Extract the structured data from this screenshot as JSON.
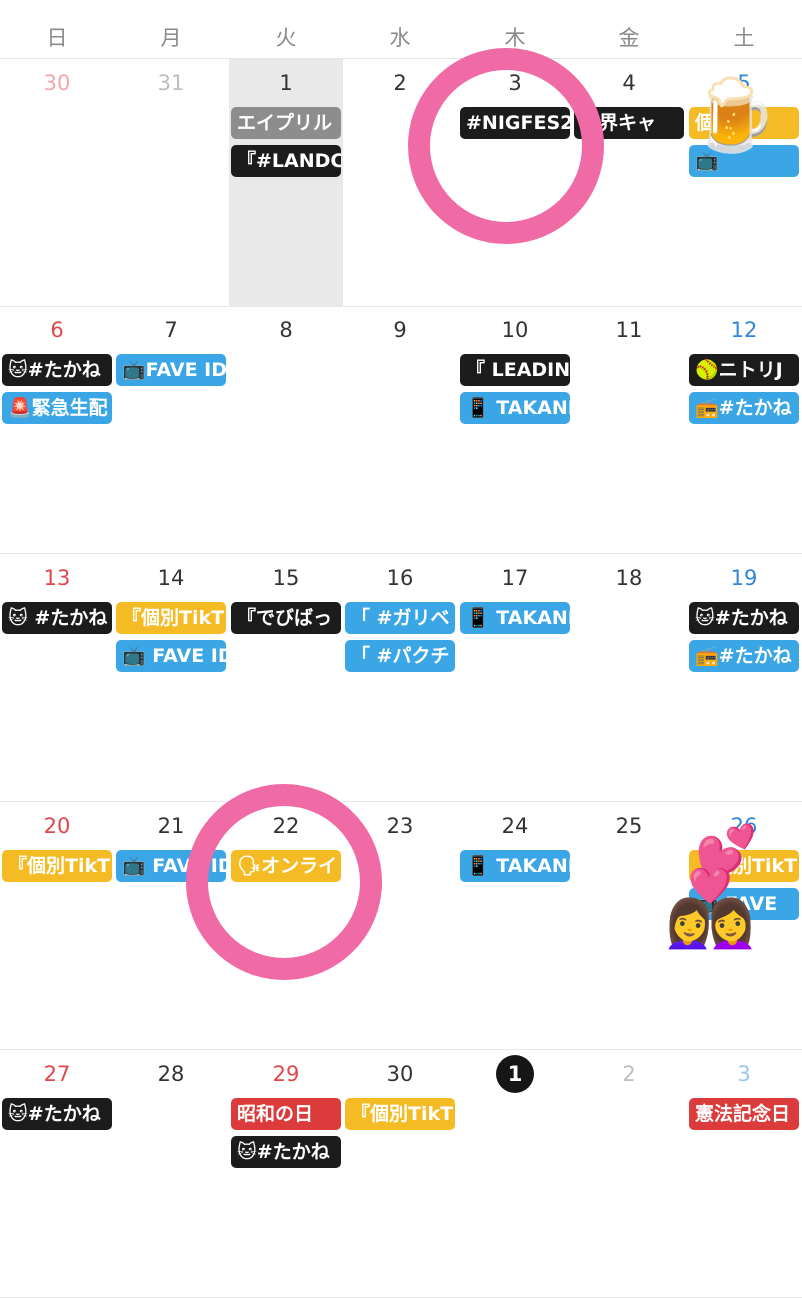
{
  "weekdays": [
    "日",
    "月",
    "火",
    "水",
    "木",
    "金",
    "土"
  ],
  "colors": {
    "black": "#1c1c1c",
    "blue": "#3ba6e6",
    "yellow": "#f5bb24",
    "gray": "#8d8d8d",
    "red": "#db3b3a",
    "highlight_ring": "#f06aa6",
    "today_bg": "#161616"
  },
  "weeks": [
    {
      "days": [
        {
          "num": "30",
          "muted": true,
          "events": []
        },
        {
          "num": "31",
          "muted": true,
          "events": []
        },
        {
          "num": "1",
          "highlight": true,
          "events": [
            {
              "text": "エイプリル",
              "color": "gray"
            },
            {
              "text": "『#LANDC",
              "color": "black"
            }
          ]
        },
        {
          "num": "2",
          "events": []
        },
        {
          "num": "3",
          "events": [
            {
              "text": "#NIGFES2(",
              "color": "black"
            }
          ]
        },
        {
          "num": "4",
          "events": [
            {
              "text": "世界キャ",
              "color": "black"
            }
          ]
        },
        {
          "num": "5",
          "events": [
            {
              "text": "個別",
              "color": "yellow"
            },
            {
              "text": "📺",
              "color": "blue"
            }
          ]
        }
      ]
    },
    {
      "days": [
        {
          "num": "6",
          "events": [
            {
              "text": "🐱#たかね",
              "color": "black"
            },
            {
              "text": "🚨緊急生配",
              "color": "blue"
            }
          ]
        },
        {
          "num": "7",
          "events": [
            {
              "text": "📺FAVE ID",
              "color": "blue"
            }
          ]
        },
        {
          "num": "8",
          "events": []
        },
        {
          "num": "9",
          "events": []
        },
        {
          "num": "10",
          "events": [
            {
              "text": "『 LEADING",
              "color": "black"
            },
            {
              "text": "📱 TAKANE",
              "color": "blue"
            }
          ]
        },
        {
          "num": "11",
          "events": []
        },
        {
          "num": "12",
          "events": [
            {
              "text": "🥎ニトリJ",
              "color": "black"
            },
            {
              "text": "📻#たかね",
              "color": "blue"
            }
          ]
        }
      ]
    },
    {
      "days": [
        {
          "num": "13",
          "events": [
            {
              "text": "🐱 #たかね",
              "color": "black"
            }
          ]
        },
        {
          "num": "14",
          "events": [
            {
              "text": "『個別TikT",
              "color": "yellow"
            },
            {
              "text": "📺 FAVE ID",
              "color": "blue"
            }
          ]
        },
        {
          "num": "15",
          "events": [
            {
              "text": "『でびばっ",
              "color": "black"
            }
          ]
        },
        {
          "num": "16",
          "events": [
            {
              "text": "「 #ガリベ",
              "color": "blue"
            },
            {
              "text": "「 #パクチ",
              "color": "blue"
            }
          ]
        },
        {
          "num": "17",
          "events": [
            {
              "text": "📱 TAKANE",
              "color": "blue"
            }
          ]
        },
        {
          "num": "18",
          "events": []
        },
        {
          "num": "19",
          "events": [
            {
              "text": "🐱#たかね",
              "color": "black"
            },
            {
              "text": "📻#たかね",
              "color": "blue"
            }
          ]
        }
      ]
    },
    {
      "days": [
        {
          "num": "20",
          "events": [
            {
              "text": "『個別TikT",
              "color": "yellow"
            }
          ]
        },
        {
          "num": "21",
          "events": [
            {
              "text": "📺 FAVE ID",
              "color": "blue"
            }
          ]
        },
        {
          "num": "22",
          "events": [
            {
              "text": "🗣オンライ",
              "color": "yellow"
            }
          ]
        },
        {
          "num": "23",
          "events": []
        },
        {
          "num": "24",
          "events": [
            {
              "text": "📱 TAKANE",
              "color": "blue"
            }
          ]
        },
        {
          "num": "25",
          "events": []
        },
        {
          "num": "26",
          "events": [
            {
              "text": "『個別TikT",
              "color": "yellow"
            },
            {
              "text": "📺 FAVE",
              "color": "blue"
            }
          ]
        }
      ]
    },
    {
      "days": [
        {
          "num": "27",
          "events": [
            {
              "text": "🐱#たかね",
              "color": "black"
            }
          ]
        },
        {
          "num": "28",
          "events": []
        },
        {
          "num": "29",
          "holiday": true,
          "events": [
            {
              "text": "昭和の日",
              "color": "red"
            },
            {
              "text": "🐱#たかね",
              "color": "black"
            }
          ]
        },
        {
          "num": "30",
          "events": [
            {
              "text": "『個別TikT",
              "color": "yellow"
            }
          ]
        },
        {
          "num": "1",
          "today": true,
          "events": []
        },
        {
          "num": "2",
          "muted": true,
          "events": []
        },
        {
          "num": "3",
          "muted": true,
          "events": [
            {
              "text": "憲法記念日",
              "color": "red"
            }
          ]
        }
      ]
    }
  ],
  "stickers": {
    "beer": "🍺",
    "heart": "💕",
    "couple": "👩‍❤️‍👩"
  }
}
